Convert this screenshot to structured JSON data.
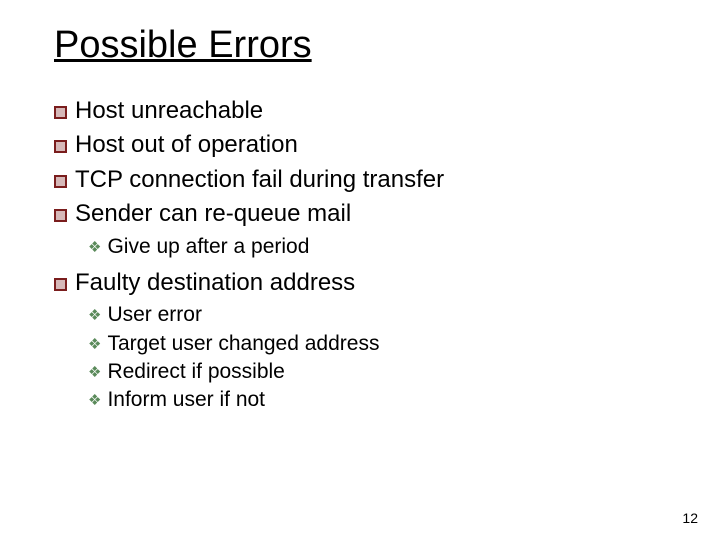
{
  "title": "Possible Errors",
  "bullets": {
    "b0": "Host unreachable",
    "b1": "Host out of operation",
    "b2": "TCP connection fail during transfer",
    "b3": "Sender can re-queue mail",
    "b3_0": "Give up after a period",
    "b4": "Faulty destination address",
    "b4_0": "User error",
    "b4_1": "Target user changed address",
    "b4_2": "Redirect if possible",
    "b4_3": "Inform user if not"
  },
  "page_number": "12"
}
